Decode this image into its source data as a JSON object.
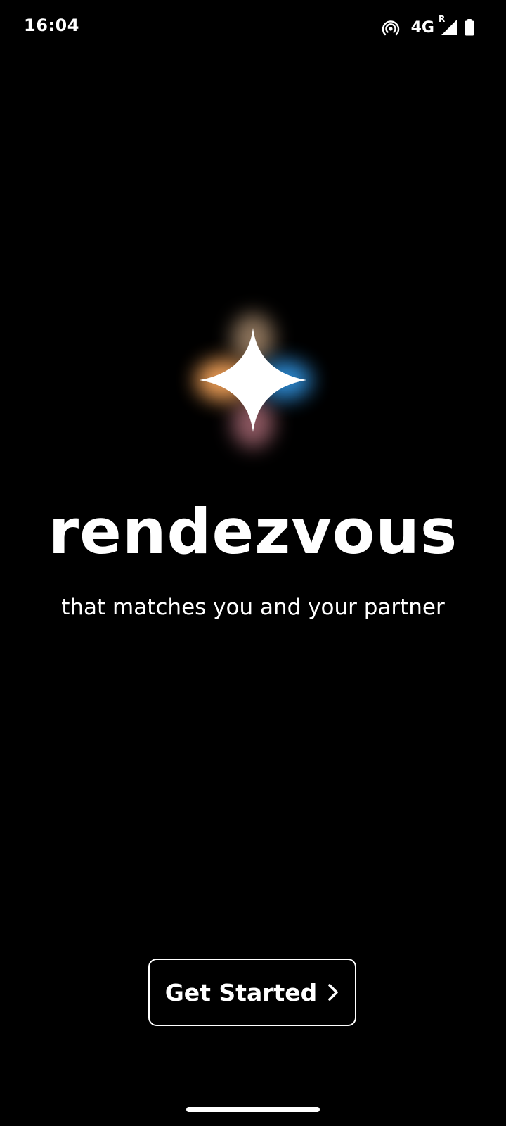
{
  "status_bar": {
    "time": "16:04",
    "network_label": "4G",
    "roaming_indicator": "R",
    "icons": [
      "hotspot-icon",
      "signal-icon",
      "battery-icon"
    ]
  },
  "logo": {
    "icon": "sparkle-icon",
    "colors": {
      "star": "#ffffff",
      "glow_warm": "#f3a259",
      "glow_cool": "#2f8ed8",
      "glow_pink": "#ff9fb0"
    }
  },
  "brand": {
    "title": "rendezvous",
    "tagline": "that matches you and your partner"
  },
  "cta": {
    "label": "Get Started",
    "icon": "chevron-right-icon"
  },
  "theme": {
    "background": "#000000",
    "foreground": "#ffffff"
  }
}
